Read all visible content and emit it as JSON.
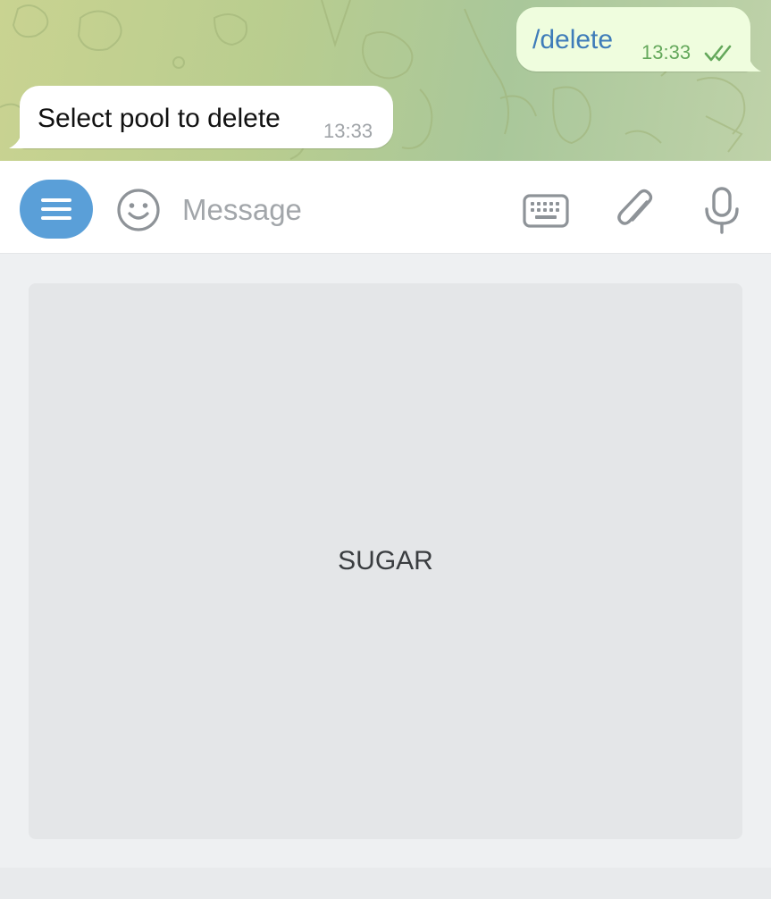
{
  "messages": {
    "outgoing": {
      "text": "/delete",
      "time": "13:33",
      "status_icon": "double-check-icon"
    },
    "incoming": {
      "text": "Select pool to delete",
      "time": "13:33"
    }
  },
  "composer": {
    "placeholder": "Message",
    "value": "",
    "icons": [
      "menu-icon",
      "emoji-icon",
      "keyboard-icon",
      "attach-icon",
      "mic-icon"
    ],
    "accent_color": "#5a9fd8"
  },
  "reply_keyboard": {
    "buttons": [
      {
        "label": "SUGAR"
      }
    ]
  },
  "colors": {
    "outgoing_bubble": "#effdde",
    "incoming_bubble": "#ffffff",
    "outgoing_text": "#3e7cb9",
    "read_check": "#64a85b"
  }
}
